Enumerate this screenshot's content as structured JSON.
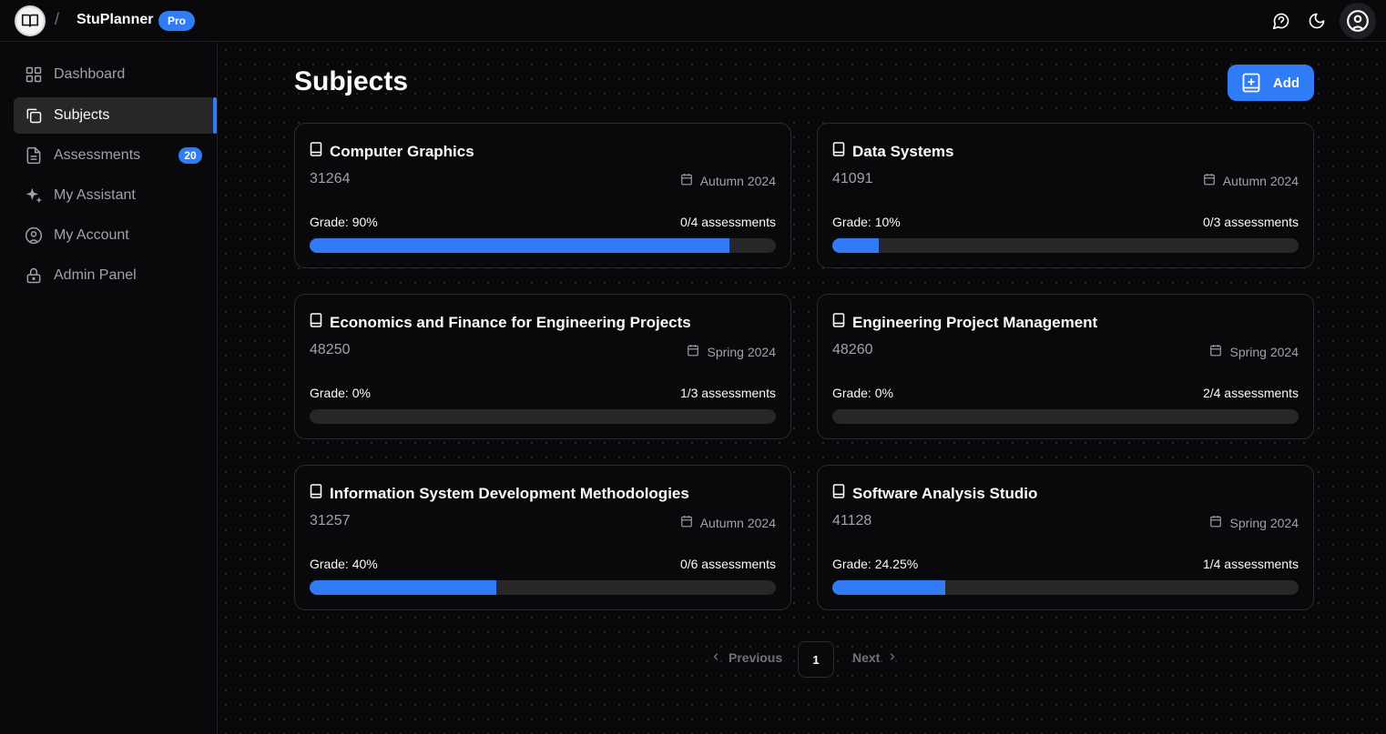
{
  "header": {
    "app_title": "StuPlanner",
    "separator": "/",
    "badge": "Pro",
    "icons": [
      "chat-icon",
      "moon-icon",
      "user-circle-icon"
    ]
  },
  "sidebar": {
    "items": [
      {
        "label": "Dashboard",
        "icon": "grid-icon"
      },
      {
        "label": "Subjects",
        "icon": "copy-icon",
        "active": true
      },
      {
        "label": "Assessments",
        "icon": "file-icon",
        "badge": "20"
      },
      {
        "label": "My Assistant",
        "icon": "sparkles-icon"
      },
      {
        "label": "My Account",
        "icon": "user-circle-icon"
      },
      {
        "label": "Admin Panel",
        "icon": "lock-icon"
      }
    ]
  },
  "main": {
    "title": "Subjects",
    "add_label": "Add",
    "subjects": [
      {
        "name": "Computer Graphics",
        "code": "31264",
        "term": "Autumn 2024",
        "grade_label": "Grade: 90%",
        "grade": 90,
        "assessments": "0/4 assessments"
      },
      {
        "name": "Data Systems",
        "code": "41091",
        "term": "Autumn 2024",
        "grade_label": "Grade: 10%",
        "grade": 10,
        "assessments": "0/3 assessments"
      },
      {
        "name": "Economics and Finance for Engineering Projects",
        "code": "48250",
        "term": "Spring 2024",
        "grade_label": "Grade: 0%",
        "grade": 0,
        "assessments": "1/3 assessments"
      },
      {
        "name": "Engineering Project Management",
        "code": "48260",
        "term": "Spring 2024",
        "grade_label": "Grade: 0%",
        "grade": 0,
        "assessments": "2/4 assessments"
      },
      {
        "name": "Information System Development Methodologies",
        "code": "31257",
        "term": "Autumn 2024",
        "grade_label": "Grade: 40%",
        "grade": 40,
        "assessments": "0/6 assessments"
      },
      {
        "name": "Software Analysis Studio",
        "code": "41128",
        "term": "Spring 2024",
        "grade_label": "Grade: 24.25%",
        "grade": 24.25,
        "assessments": "1/4 assessments"
      }
    ],
    "pagination": {
      "previous": "Previous",
      "page": "1",
      "next": "Next"
    }
  },
  "colors": {
    "accent": "#2f7cf6",
    "background": "#09090b",
    "track": "#27272a"
  }
}
